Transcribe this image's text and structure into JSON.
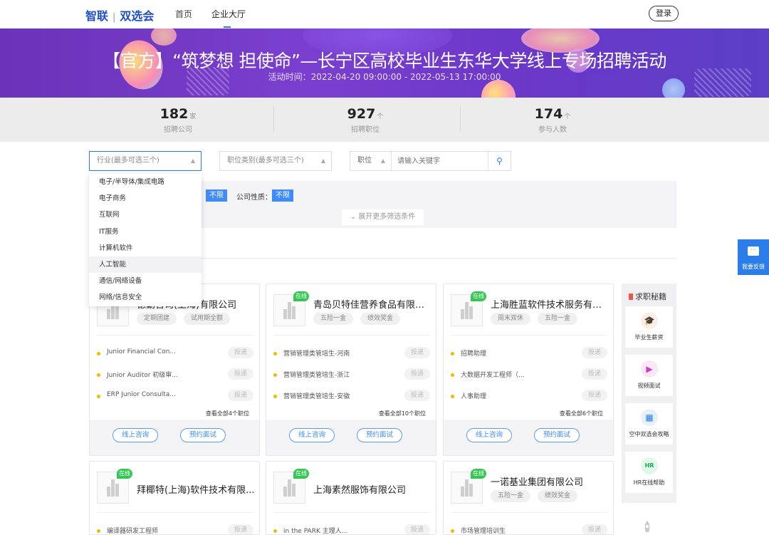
{
  "nav": {
    "brand": "智联",
    "brand_sub": "双选会",
    "links": [
      "首页",
      "企业大厅"
    ],
    "login": "登录"
  },
  "banner": {
    "title": "【官方】“筑梦想 担使命”—长宁区高校毕业生东华大学线上专场招聘活动",
    "time": "活动时间：2022-04-20 09:00:00 - 2022-05-13 17:00:00"
  },
  "stats": [
    {
      "num": "182",
      "unit": "家",
      "label": "招聘公司"
    },
    {
      "num": "927",
      "unit": "个",
      "label": "招聘职位"
    },
    {
      "num": "174",
      "unit": "个",
      "label": "参与人数"
    }
  ],
  "filters": {
    "industry_placeholder": "行业(最多可选三个)",
    "category_placeholder": "职位类别(最多可选三个)",
    "position_label": "职位",
    "keyword_placeholder": "请输入关键字",
    "unlimited_1": "不限",
    "company_nature_label": "公司性质：",
    "unlimited_2": "不限",
    "expand": "展开更多筛选条件"
  },
  "dropdown": [
    "电子/半导体/集成电路",
    "电子商务",
    "互联网",
    "IT服务",
    "计算机软件",
    "人工智能",
    "通信/网络设备",
    "网络/信息安全"
  ],
  "cards": [
    {
      "name": "德勤咨询(上海)有限公司",
      "online": false,
      "tags": [
        "定期团建",
        "试用期全额"
      ],
      "jobs": [
        "Junior Financial Con...",
        "Junior Auditor 初级审...",
        "ERP Junior Consulta..."
      ],
      "viewall": "查看全部4个职位"
    },
    {
      "name": "青岛贝特佳营养食品有限公司",
      "online": true,
      "tags": [
        "五险一金",
        "绩效奖金"
      ],
      "jobs": [
        "营销管理类管培生-河南",
        "营销管理类管培生-浙江",
        "营销管理类管培生-安徽"
      ],
      "viewall": "查看全部10个职位"
    },
    {
      "name": "上海胜蓝软件技术服务有限...",
      "online": true,
      "tags": [
        "周末双休",
        "五险一金"
      ],
      "jobs": [
        "招聘助理",
        "大数据开发工程师（...",
        "人事助理"
      ],
      "viewall": "查看全部6个职位"
    },
    {
      "name": "拜椰特(上海)软件技术有限...",
      "online": true,
      "tags": [],
      "jobs": [
        "编译器研发工程师"
      ]
    },
    {
      "name": "上海素然服饰有限公司",
      "online": true,
      "tags": [],
      "jobs": [
        "in the PARK 主理人..."
      ]
    },
    {
      "name": "一诺基业集团有限公司",
      "online": true,
      "tags": [
        "五险一金",
        "绩效奖金"
      ],
      "jobs": [
        "市场管理培训生"
      ]
    }
  ],
  "card_labels": {
    "apply": "投递",
    "consult": "线上咨询",
    "interview": "预约面试",
    "online": "在线"
  },
  "sidebar": {
    "title": "求职秘籍",
    "items": [
      "毕业生薪资",
      "视频面试",
      "空中双选会攻略",
      "HR在线帮助"
    ]
  },
  "feedback": "我要反馈",
  "colors": {
    "primary": "#2b7de9",
    "online": "#36c653",
    "bullet": "#f5b800",
    "banner": "#6a33b8"
  }
}
